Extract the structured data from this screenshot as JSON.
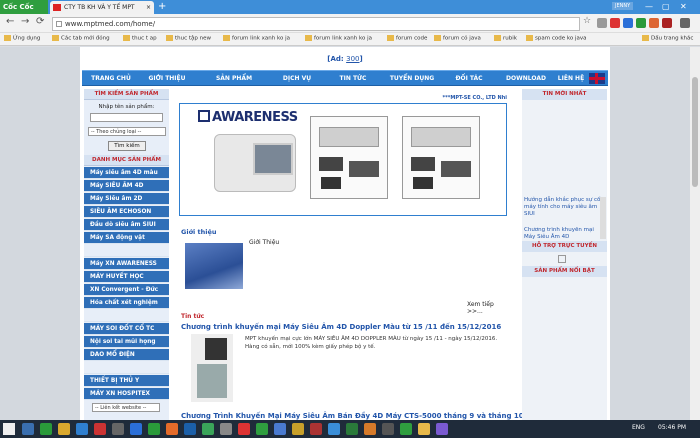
{
  "browser": {
    "brand": "Cốc Cốc",
    "tab_title": "CTY TB KH VÀ Y TẾ MPT",
    "tab_close": "×",
    "new_tab": "+",
    "user": "JENNY",
    "url": "www.mptmed.com/home/",
    "back": "←",
    "forward": "→",
    "reload": "⟳",
    "star": "☆"
  },
  "bookmarks": [
    "Ứng dụng",
    "Các tab mới đóng",
    "thuc t ap",
    "thuc tập new",
    "forum link xanh ko ja",
    "forum link xanh ko ja",
    "forum code",
    "forum có java",
    "rubik",
    "spam code ko java"
  ],
  "bookmarks_right": "Dấu trang khác",
  "site": {
    "ad_prefix": "[Ad: ",
    "ad_link": "300",
    "ad_suffix": "]",
    "menu": [
      "TRANG CHỦ",
      "GIỚI THIỆU",
      "SẢN PHẨM",
      "DỊCH VỤ",
      "TIN TỨC",
      "TUYỂN DỤNG",
      "ĐỐI TÁC",
      "DOWNLOAD",
      "LIÊN HỆ"
    ],
    "search": {
      "heading": "TÌM KIẾM SẢN PHẨM",
      "label": "Nhập tên sản phẩm:",
      "select": "-- Theo chủng loại --",
      "button": "Tìm kiếm"
    },
    "category_heading": "DANH MỤC SẢN PHẨM",
    "categories": [
      "Máy siêu âm 4D màu",
      "Máy SIÊU ÂM 4D",
      "Máy Siêu âm 2D",
      "SIÊU ÂM ECHOSON",
      "Đầu dò siêu âm SIUI",
      "Máy SA động vật",
      "",
      "Máy XN AWARENESS",
      "MÁY HUYẾT HỌC",
      "XN Convergent - Đức",
      "Hóa chất xét nghiệm",
      "",
      "MÁY SOI ĐỐT CỔ TC",
      "Nội soi tai mũi họng",
      "DAO MỔ ĐIỆN",
      "",
      "THIẾT BỊ THỦ Y",
      "MÁY XN HOSPITEX"
    ],
    "website_select": "-- Liên kết website --",
    "slogan": "***MPT-SE CO., LTD Nhi",
    "banner_logo": "AWARENESS",
    "intro": {
      "heading": "Giới thiệu",
      "text": "Giới Thiệu",
      "more": "Xem tiếp >>..."
    },
    "news": {
      "heading": "Tin tức",
      "title1": "Chương trình khuyến mại Máy Siêu Âm 4D Doppler Màu từ 15 /11 đến 15/12/2016",
      "text1": "MPT khuyến mại cực lớn MÁY SIÊU ÂM 4D DOPPLER MÀU từ ngày 15 /11 - ngày 15/12/2016. Hàng có sẵn, mới 100% kèm giấy phép bộ y tế.",
      "title2": "Chương Trình Khuyến Mại Máy Siêu Âm Bán Đầy 4D Máy CTS-5000 tháng 9 và tháng 10"
    },
    "right": {
      "latest": "TIN MỚI NHẤT",
      "links": [
        "Hướng dẫn khắc phục sự cố máy tính cho máy siêu âm SIUI",
        "Chương trình khuyến mại Máy Siêu Âm 4D"
      ],
      "support": "HỖ TRỢ TRỰC TUYẾN",
      "featured": "SẢN PHẨM NỔI BẬT"
    }
  },
  "taskbar": {
    "lang": "ENG",
    "time": "05:46 PM"
  }
}
